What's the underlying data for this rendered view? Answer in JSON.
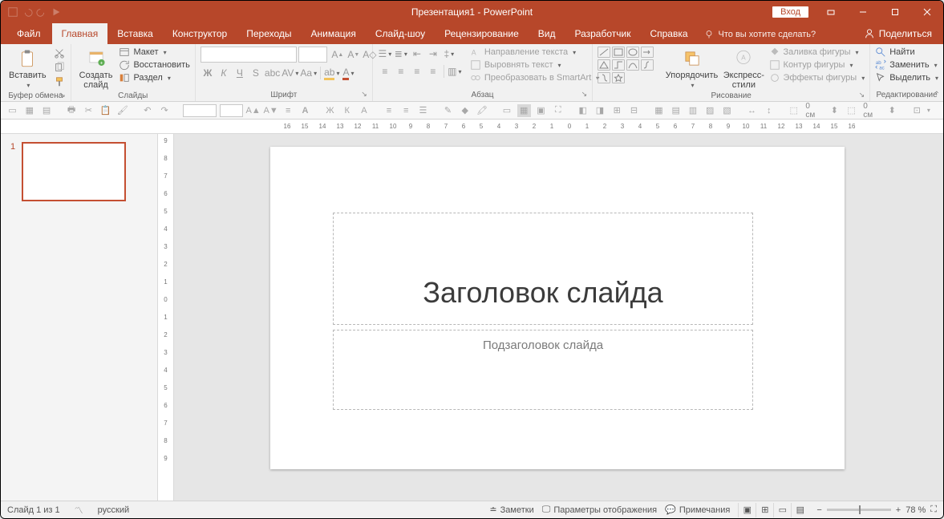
{
  "title": "Презентация1  -  PowerPoint",
  "login": "Вход",
  "tabs": {
    "file": "Файл",
    "home": "Главная",
    "insert": "Вставка",
    "design": "Конструктор",
    "transitions": "Переходы",
    "animations": "Анимация",
    "slideshow": "Слайд-шоу",
    "review": "Рецензирование",
    "view": "Вид",
    "developer": "Разработчик",
    "help": "Справка"
  },
  "tell_me": "Что вы хотите сделать?",
  "share": "Поделиться",
  "ribbon": {
    "clipboard": {
      "label": "Буфер обмена",
      "paste": "Вставить"
    },
    "slides": {
      "label": "Слайды",
      "new_slide": "Создать\nслайд",
      "layout": "Макет",
      "reset": "Восстановить",
      "section": "Раздел"
    },
    "font": {
      "label": "Шрифт"
    },
    "paragraph": {
      "label": "Абзац",
      "text_direction": "Направление текста",
      "align_text": "Выровнять текст",
      "smartart": "Преобразовать в SmartArt"
    },
    "drawing": {
      "label": "Рисование",
      "arrange": "Упорядочить",
      "quick_styles": "Экспресс-\nстили",
      "shape_fill": "Заливка фигуры",
      "shape_outline": "Контур фигуры",
      "shape_effects": "Эффекты фигуры"
    },
    "editing": {
      "label": "Редактирование",
      "find": "Найти",
      "replace": "Заменить",
      "select": "Выделить"
    }
  },
  "cmdbar": {
    "cm1": "0 см",
    "cm2": "0 см"
  },
  "ruler_h": [
    "16",
    "15",
    "14",
    "13",
    "12",
    "11",
    "10",
    "9",
    "8",
    "7",
    "6",
    "5",
    "4",
    "3",
    "2",
    "1",
    "0",
    "1",
    "2",
    "3",
    "4",
    "5",
    "6",
    "7",
    "8",
    "9",
    "10",
    "11",
    "12",
    "13",
    "14",
    "15",
    "16"
  ],
  "ruler_v": [
    "9",
    "8",
    "7",
    "6",
    "5",
    "4",
    "3",
    "2",
    "1",
    "0",
    "1",
    "2",
    "3",
    "4",
    "5",
    "6",
    "7",
    "8",
    "9"
  ],
  "slide": {
    "number": "1",
    "title_placeholder": "Заголовок слайда",
    "subtitle_placeholder": "Подзаголовок слайда"
  },
  "status": {
    "slide_counter": "Слайд 1 из 1",
    "language": "русский",
    "notes": "Заметки",
    "display_settings": "Параметры отображения",
    "comments": "Примечания",
    "zoom": "78 %"
  }
}
